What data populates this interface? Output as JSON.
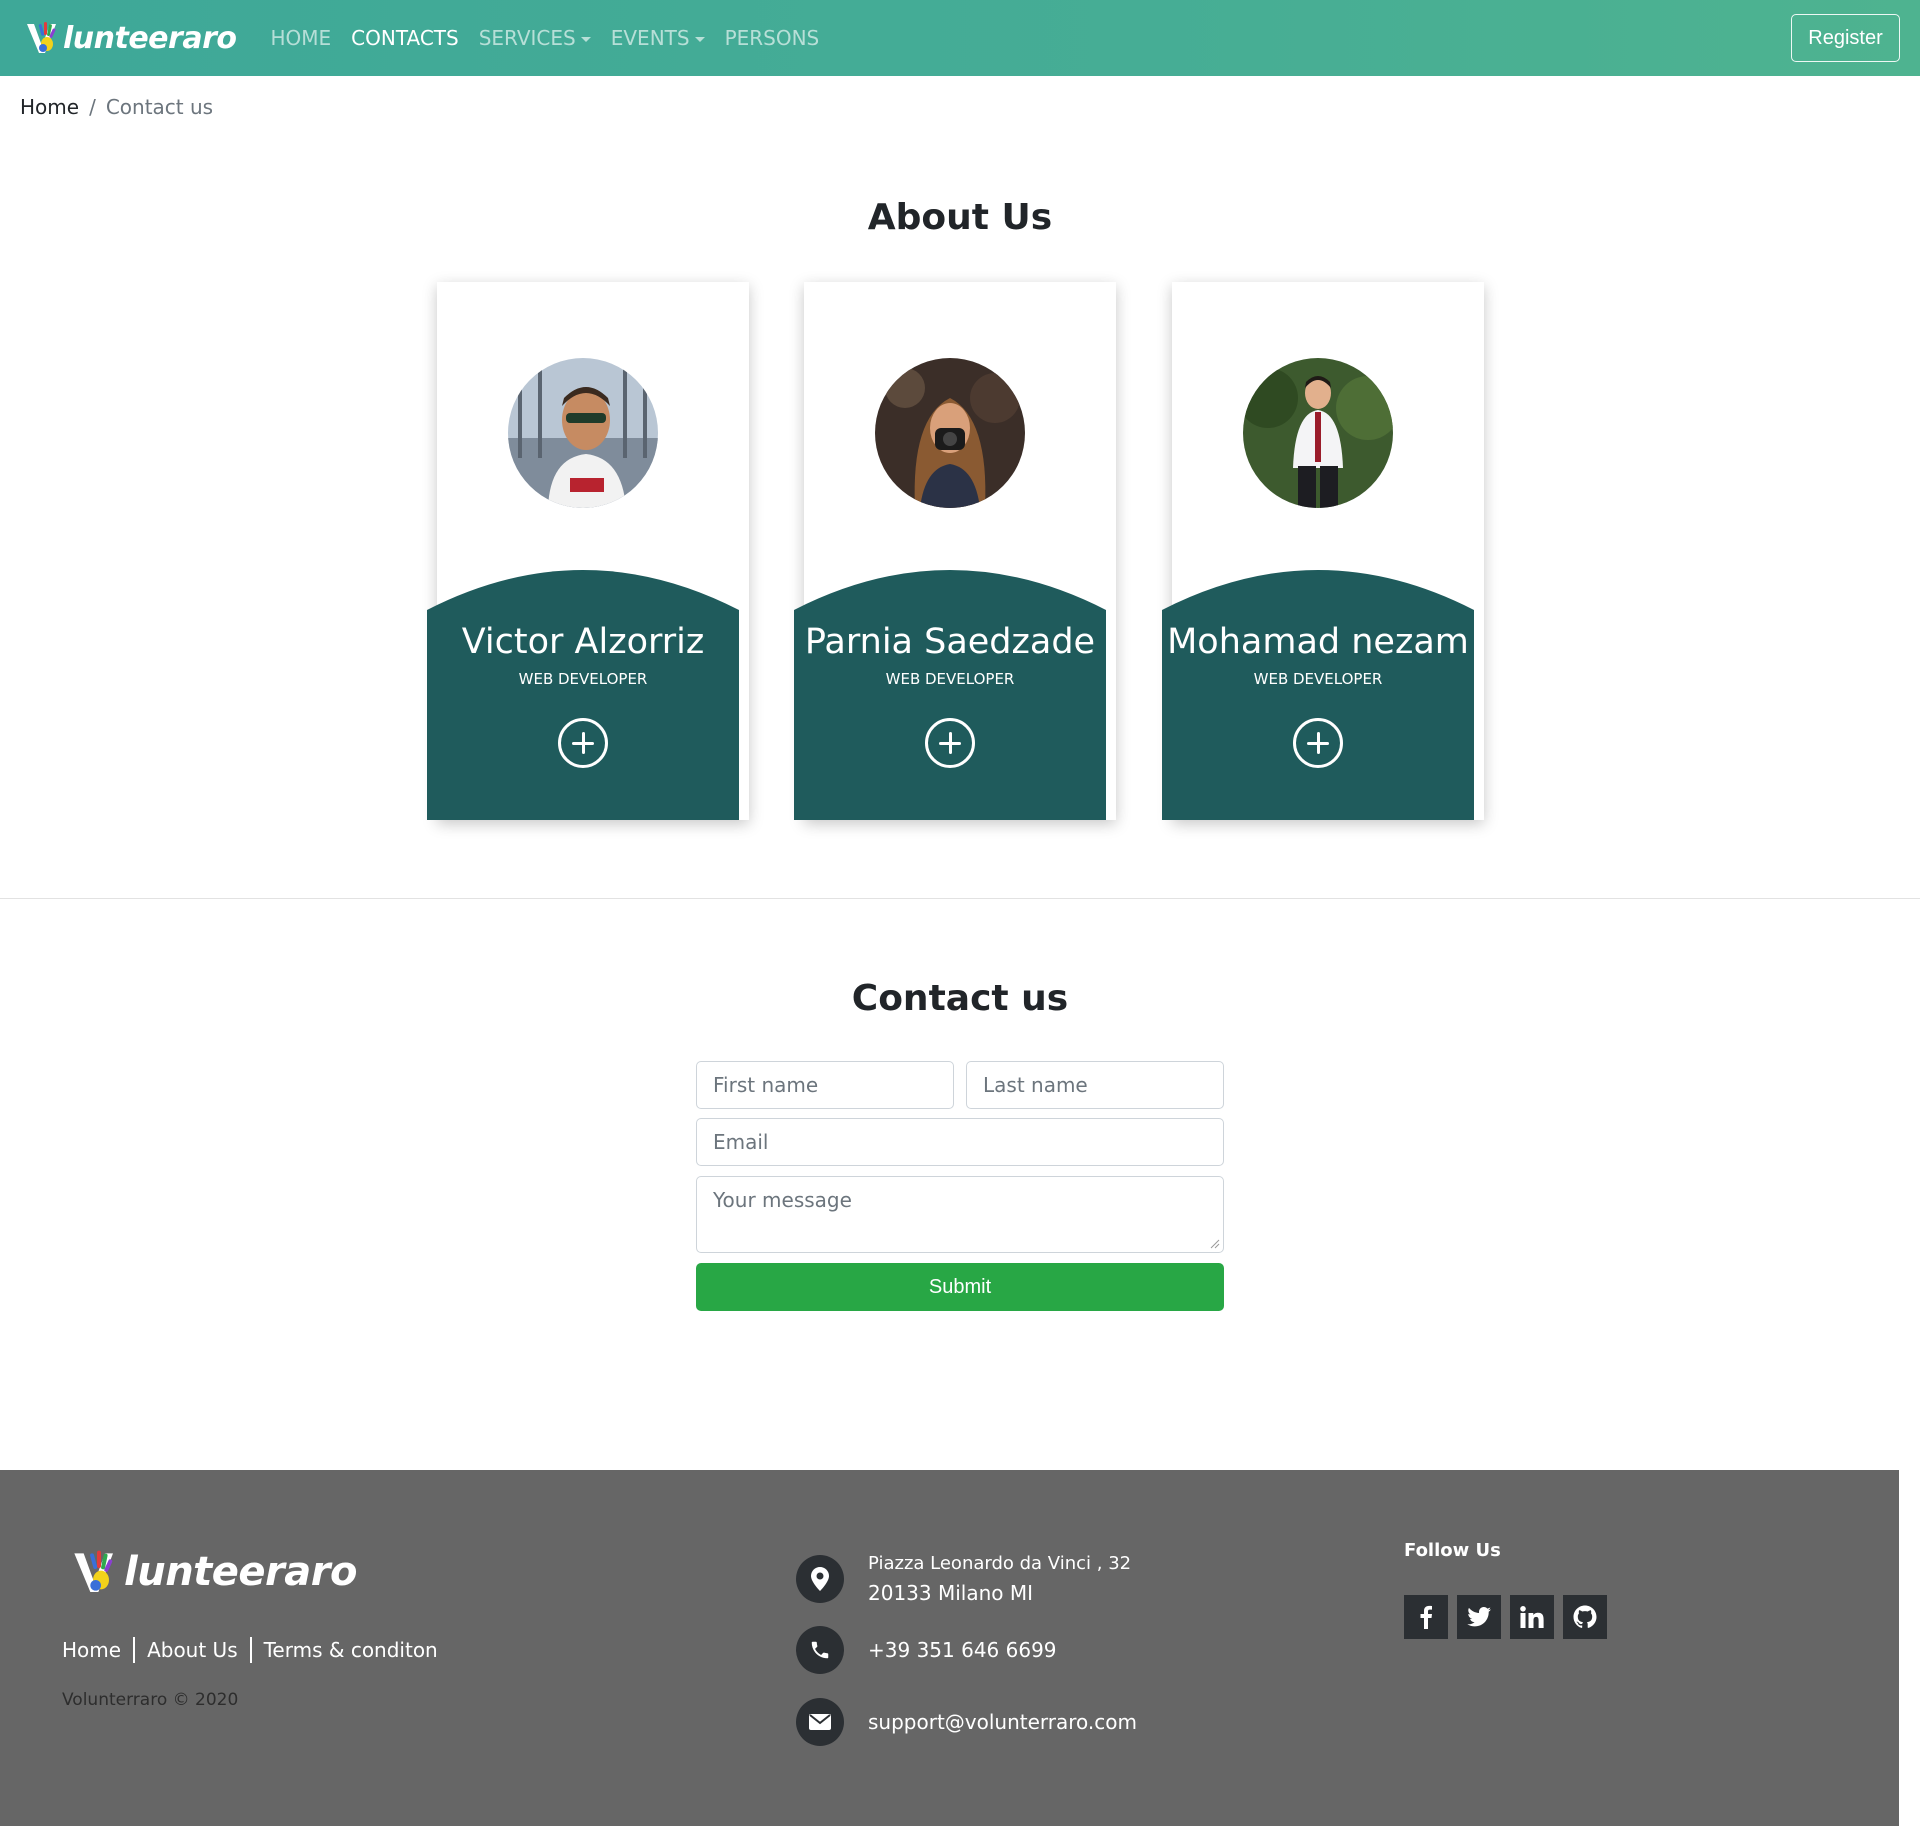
{
  "navbar": {
    "brand_suffix": "lunteeraro",
    "links": [
      {
        "label": "HOME",
        "active": false,
        "dropdown": false
      },
      {
        "label": "CONTACTS",
        "active": true,
        "dropdown": false
      },
      {
        "label": "SERVICES",
        "active": false,
        "dropdown": true
      },
      {
        "label": "EVENTS",
        "active": false,
        "dropdown": true
      },
      {
        "label": "PERSONS",
        "active": false,
        "dropdown": false
      }
    ],
    "register_label": "Register"
  },
  "breadcrumb": {
    "home": "Home",
    "separator": "/",
    "current": "Contact us"
  },
  "about": {
    "title": "About Us",
    "members": [
      {
        "name": "Victor Alzorriz",
        "role": "WEB DEVELOPER"
      },
      {
        "name": "Parnia Saedzade",
        "role": "WEB DEVELOPER"
      },
      {
        "name": "Mohamad nezam",
        "role": "WEB DEVELOPER"
      }
    ]
  },
  "contact": {
    "title": "Contact us",
    "first_name_placeholder": "First name",
    "last_name_placeholder": "Last name",
    "email_placeholder": "Email",
    "message_placeholder": "Your message",
    "submit_label": "Submit"
  },
  "footer": {
    "brand_suffix": "lunteeraro",
    "links": [
      "Home",
      "About Us",
      "Terms & conditon"
    ],
    "copyright": "Volunterraro © 2020",
    "address_line1": "Piazza Leonardo da Vinci , 32",
    "address_line2": "20133 Milano MI",
    "phone": "+39 351 646 6699",
    "email": "support@volunterraro.com",
    "follow_title": "Follow Us",
    "socials": [
      "facebook-icon",
      "twitter-icon",
      "linkedin-icon",
      "github-icon"
    ]
  },
  "colors": {
    "nav_start": "#3ea898",
    "nav_end": "#4eb390",
    "card_accent": "#1f5b5c",
    "submit": "#28a745",
    "footer_bg": "#666666",
    "icon_bg": "#2b2f33"
  }
}
